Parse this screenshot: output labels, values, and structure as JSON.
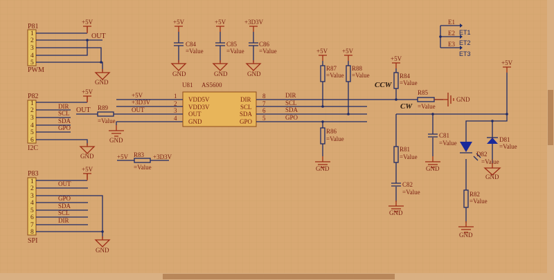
{
  "p81": {
    "ref": "P81",
    "name": "PWM",
    "pins": [
      "1",
      "2",
      "3",
      "4",
      "5"
    ],
    "net_out": "OUT",
    "pwr": "+5V",
    "gnd": "GND"
  },
  "caps_top": [
    {
      "ref": "C84",
      "value": "=Value",
      "pwr": "+5V",
      "gnd": "GND"
    },
    {
      "ref": "C85",
      "value": "=Value",
      "pwr": "+5V",
      "gnd": "GND"
    },
    {
      "ref": "C86",
      "value": "=Value",
      "pwr": "+3D3V",
      "gnd": "GND"
    }
  ],
  "p82": {
    "ref": "P82",
    "name": "I2C",
    "pins": [
      "1",
      "2",
      "3",
      "4",
      "5",
      "6"
    ],
    "nets": [
      "DIR",
      "SCL",
      "SDA",
      "GPO"
    ],
    "pwr": "+5V",
    "gnd": "GND",
    "out": "OUT"
  },
  "r89": {
    "ref": "R89",
    "value": "=Value",
    "gnd": "GND"
  },
  "u81": {
    "ref": "U81",
    "part": "AS5600",
    "left_pins": [
      {
        "num": "1",
        "name": "VDD5V",
        "net": "+5V"
      },
      {
        "num": "2",
        "name": "VDD3V",
        "net": "+3D3V"
      },
      {
        "num": "3",
        "name": "OUT",
        "net": "OUT"
      },
      {
        "num": "4",
        "name": "GND",
        "net": ""
      }
    ],
    "right_pins": [
      {
        "num": "8",
        "name": "DIR",
        "net": "DIR"
      },
      {
        "num": "7",
        "name": "SCL",
        "net": "SCL"
      },
      {
        "num": "6",
        "name": "SDA",
        "net": "SDA"
      },
      {
        "num": "5",
        "name": "GPO",
        "net": "GPO"
      }
    ]
  },
  "r83": {
    "ref": "R83",
    "value": "=Value",
    "left": "+5V",
    "right": "+3D3V"
  },
  "p83": {
    "ref": "P83",
    "name": "SPI",
    "pins": [
      "1",
      "2",
      "3",
      "4",
      "5",
      "6",
      "7",
      "8"
    ],
    "nets": [
      "OUT",
      "GPO",
      "SDA",
      "SCL",
      "DIR"
    ],
    "pwr": "+5V",
    "gnd": "GND"
  },
  "pullups": [
    {
      "ref": "R87",
      "value": "=Value",
      "pwr": "+5V"
    },
    {
      "ref": "R88",
      "value": "=Value",
      "pwr": "+5V"
    },
    {
      "ref": "R86",
      "value": "=Value",
      "gnd": "GND"
    }
  ],
  "dir_circuit": {
    "r84": "R84",
    "r84_value": "=Value",
    "pwr": "+5V",
    "ccw": "CCW",
    "r85": "R85",
    "r85_value": "=Value",
    "cw": "CW",
    "gnd": "GND"
  },
  "power_circuit": {
    "pwr": "+5V",
    "c81": "C81",
    "c81_value": "=Value",
    "r81": "R81",
    "r81_value": "=Value",
    "c82": "C82",
    "c82_value": "=Value",
    "d81": "D81",
    "d81_value": "=Value",
    "d82": "D82",
    "d82_value": "=Value",
    "r82": "R82",
    "r82_value": "=Value",
    "gnd": "GND"
  },
  "ports": [
    {
      "net": "E1",
      "label": "ET1"
    },
    {
      "net": "E2",
      "label": "ET2"
    },
    {
      "net": "E3",
      "label": "ET3"
    }
  ],
  "colors": {
    "background": "#d8a873",
    "wire": "#1e2a66",
    "power": "#9c2a14",
    "connector": "#e8c462"
  }
}
